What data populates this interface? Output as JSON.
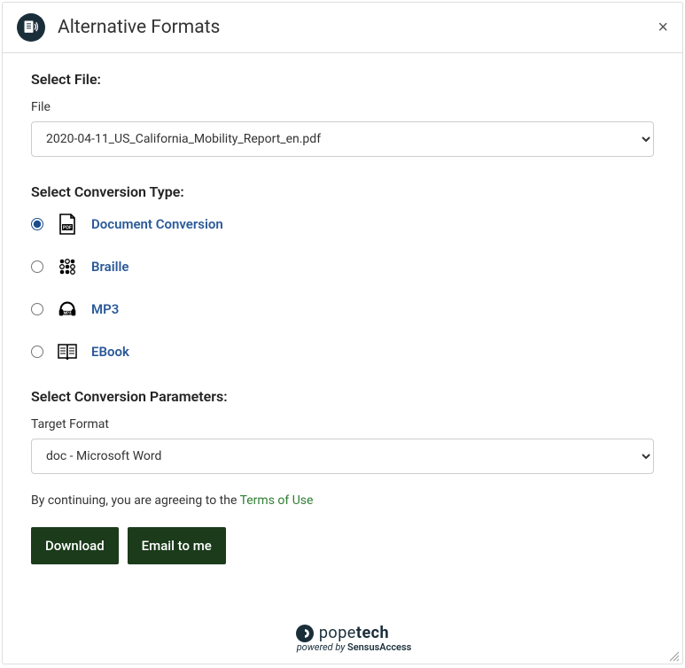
{
  "header": {
    "title": "Alternative Formats",
    "close": "×"
  },
  "selectFile": {
    "sectionLabel": "Select File:",
    "fieldLabel": "File",
    "selected": "2020-04-11_US_California_Mobility_Report_en.pdf"
  },
  "conversionType": {
    "sectionLabel": "Select Conversion Type:",
    "options": [
      {
        "label": "Document Conversion",
        "icon": "pdf-icon",
        "checked": true
      },
      {
        "label": "Braille",
        "icon": "braille-icon",
        "checked": false
      },
      {
        "label": "MP3",
        "icon": "mp3-icon",
        "checked": false
      },
      {
        "label": "EBook",
        "icon": "ebook-icon",
        "checked": false
      }
    ]
  },
  "conversionParams": {
    "sectionLabel": "Select Conversion Parameters:",
    "fieldLabel": "Target Format",
    "selected": "doc - Microsoft Word"
  },
  "terms": {
    "prefix": "By continuing, you are agreeing to the ",
    "linkText": "Terms of Use"
  },
  "buttons": {
    "download": "Download",
    "email": "Email to me"
  },
  "footer": {
    "brandLight": "pope",
    "brandBold": "tech",
    "poweredPrefix": "powered by ",
    "poweredBrand": "SensusAccess"
  }
}
